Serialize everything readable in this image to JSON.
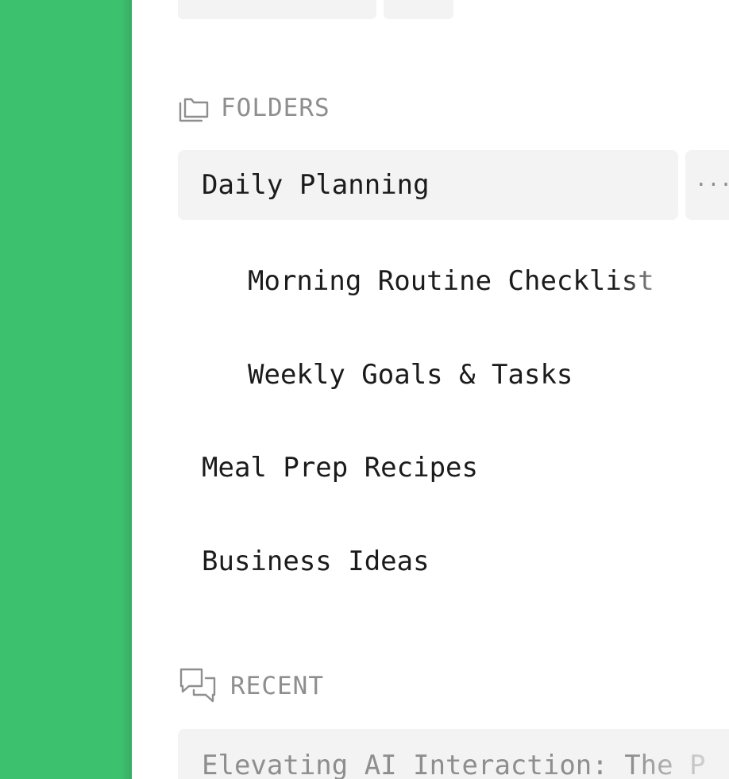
{
  "folders_section": {
    "icon": "folder-icon",
    "title": "FOLDERS"
  },
  "folders": [
    {
      "label": "Daily Planning",
      "selected": true
    },
    {
      "label": "Morning Routine Checklist",
      "nested": true
    },
    {
      "label": "Weekly Goals & Tasks",
      "nested": true
    },
    {
      "label": "Meal Prep Recipes"
    },
    {
      "label": "Business Ideas"
    }
  ],
  "more_button": {
    "icon": "more-horizontal-icon",
    "label": "···"
  },
  "recent_section": {
    "icon": "chat-bubbles-icon",
    "title": "RECENT"
  },
  "recent": [
    {
      "title": "Elevating AI Interaction: The P"
    }
  ],
  "colors": {
    "accent_green": "#3cc16f",
    "row_bg": "#f3f3f3",
    "muted_text": "#8e8e8e",
    "primary_text": "#1b1b1b"
  }
}
